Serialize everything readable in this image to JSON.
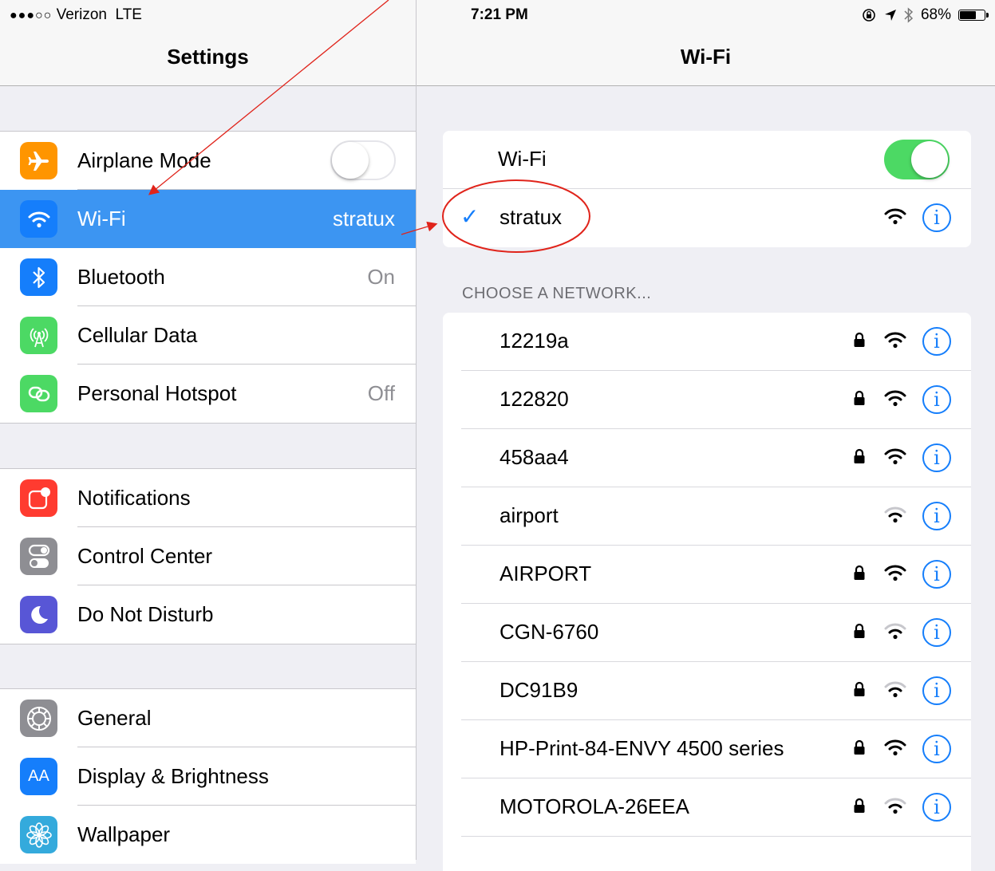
{
  "status_bar": {
    "signal": "●●●○○",
    "carrier": "Verizon",
    "network": "LTE",
    "time": "7:21 PM",
    "battery": "68%",
    "battery_level": 0.68
  },
  "left": {
    "title": "Settings",
    "group1": [
      {
        "label": "Airplane Mode",
        "icon": "airplane-icon",
        "color": "#ff9500",
        "toggle": "off"
      },
      {
        "label": "Wi-Fi",
        "icon": "wifi-icon",
        "color": "#157efb",
        "value": "stratux",
        "selected": true
      },
      {
        "label": "Bluetooth",
        "icon": "bluetooth-icon",
        "color": "#157efb",
        "value": "On"
      },
      {
        "label": "Cellular Data",
        "icon": "cellular-icon",
        "color": "#4cd964"
      },
      {
        "label": "Personal Hotspot",
        "icon": "hotspot-icon",
        "color": "#4cd964",
        "value": "Off"
      }
    ],
    "group2": [
      {
        "label": "Notifications",
        "icon": "notifications-icon",
        "color": "#ff3b30"
      },
      {
        "label": "Control Center",
        "icon": "control-center-icon",
        "color": "#8e8e93"
      },
      {
        "label": "Do Not Disturb",
        "icon": "moon-icon",
        "color": "#5856d6"
      }
    ],
    "group3": [
      {
        "label": "General",
        "icon": "gear-icon",
        "color": "#8e8e93"
      },
      {
        "label": "Display & Brightness",
        "icon": "display-icon",
        "color": "#157efb",
        "icon_text": "AA"
      },
      {
        "label": "Wallpaper",
        "icon": "wallpaper-icon",
        "color": "#34aadc"
      }
    ]
  },
  "right": {
    "title": "Wi-Fi",
    "wifi_label": "Wi-Fi",
    "wifi_toggle": "on",
    "connected": "stratux",
    "section": "CHOOSE A NETWORK...",
    "networks": [
      {
        "name": "12219a",
        "locked": true,
        "strength": 3
      },
      {
        "name": "122820",
        "locked": true,
        "strength": 3
      },
      {
        "name": "458aa4",
        "locked": true,
        "strength": 3
      },
      {
        "name": "airport",
        "locked": false,
        "strength": 2
      },
      {
        "name": "AIRPORT",
        "locked": true,
        "strength": 3
      },
      {
        "name": "CGN-6760",
        "locked": true,
        "strength": 2
      },
      {
        "name": "DC91B9",
        "locked": true,
        "strength": 2
      },
      {
        "name": "HP-Print-84-ENVY 4500 series",
        "locked": true,
        "strength": 3
      },
      {
        "name": "MOTOROLA-26EEA",
        "locked": true,
        "strength": 2
      },
      {
        "name": "",
        "locked": false,
        "strength": 0
      }
    ],
    "info_glyph": "i",
    "check_glyph": "✓"
  },
  "colors": {
    "accent": "#157efb",
    "selected_row": "#3c95f2",
    "toggle_on": "#4cd964",
    "annotation": "#e0241b"
  }
}
